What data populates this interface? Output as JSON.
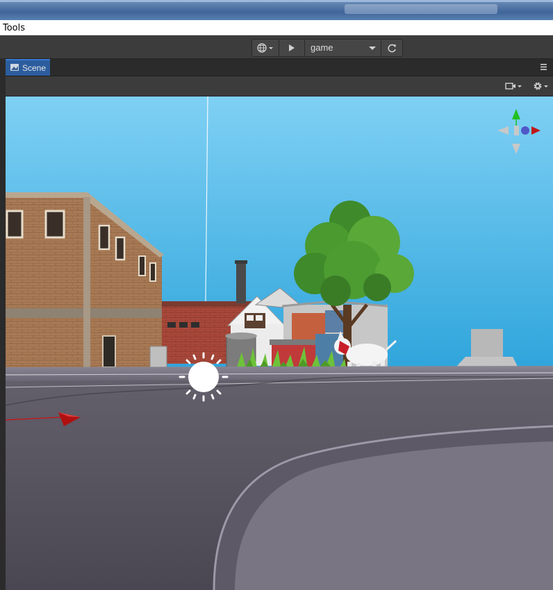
{
  "window": {
    "menu": [
      "Tools"
    ]
  },
  "toolbar": {
    "env_dropdown": {
      "selected": "game"
    },
    "icons": [
      "globe-icon",
      "play-icon",
      "refresh-icon"
    ]
  },
  "scene_tab": {
    "label": "Scene",
    "icon": "scene-icon"
  },
  "scene_toolbar": {
    "icons": [
      "camera-icon",
      "gear-icon"
    ]
  },
  "colors": {
    "tab_active": "#2c5d9e",
    "panel": "#3c3c3c",
    "sky": "#6cc8ef",
    "ground": "#5e5a66"
  }
}
